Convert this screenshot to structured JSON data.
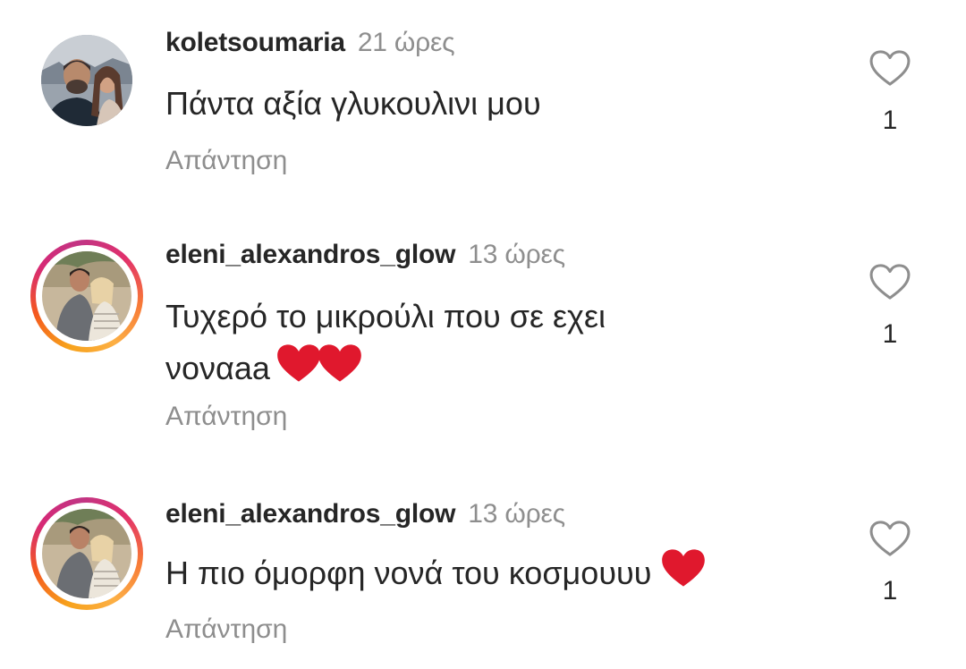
{
  "comments": [
    {
      "username": "koletsoumaria",
      "time": "21 ώρες",
      "text": "Πάντα αξία γλυκουλινι μου",
      "reply_label": "Απάντηση",
      "likes": "1",
      "has_story": false
    },
    {
      "username": "eleni_alexandros_glow",
      "time": "13 ώρες",
      "text_line1": "Τυχερό το μικρούλι που σε εχει",
      "text_line2": "νοναaa",
      "reply_label": "Απάντηση",
      "likes": "1",
      "has_story": true
    },
    {
      "username": "eleni_alexandros_glow",
      "time": "13 ώρες",
      "text": "Η πιο όμορφη νονά του κοσμουυυ",
      "reply_label": "Απάντηση",
      "likes": "1",
      "has_story": true
    }
  ],
  "icons": {
    "like": "heart-outline-icon",
    "emoji": "red-heart-emoji"
  },
  "colors": {
    "text": "#262626",
    "muted": "#8e8e8e",
    "emoji_red": "#e0182d"
  }
}
